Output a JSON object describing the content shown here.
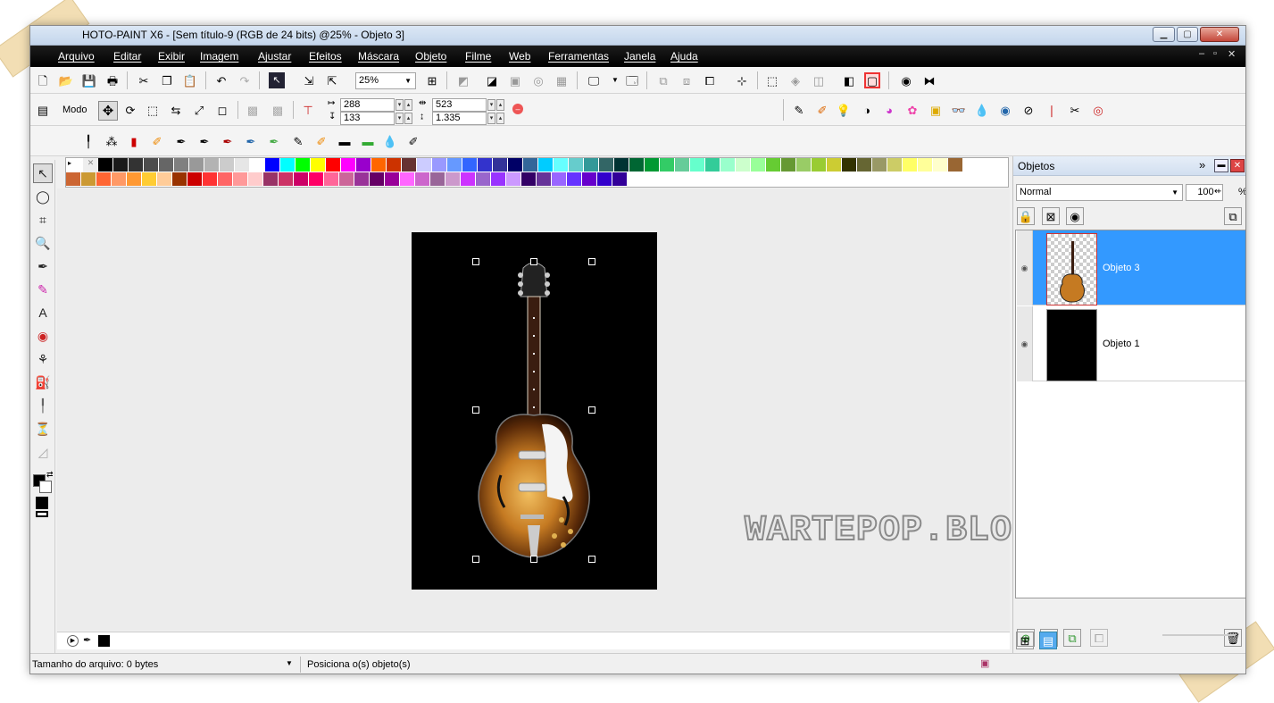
{
  "window": {
    "title": "HOTO-PAINT X6 - [Sem título-9 (RGB de 24 bits) @25% - Objeto 3]",
    "controls": [
      "minimize",
      "maximize",
      "close"
    ]
  },
  "menu": [
    "Arquivo",
    "Editar",
    "Exibir",
    "Imagem",
    "Ajustar",
    "Efeitos",
    "Máscara",
    "Objeto",
    "Filme",
    "Web",
    "Ferramentas",
    "Janela",
    "Ajuda"
  ],
  "toolbar": {
    "zoom": "25%"
  },
  "property_bar": {
    "mode_label": "Modo",
    "x": "288",
    "y": "133",
    "width": "523",
    "height": "1.335"
  },
  "objects_panel": {
    "title": "Objetos",
    "blend_mode": "Normal",
    "opacity": "100",
    "opacity_unit": "%",
    "layers": [
      {
        "name": "Objeto 3",
        "selected": true
      },
      {
        "name": "Objeto 1",
        "selected": false
      }
    ]
  },
  "watermark": "WARTEPOP.BLOGSPOT.COM",
  "status": {
    "file_size": "Tamanho do arquivo: 0 bytes",
    "hint": "Posiciona o(s) objeto(s)"
  },
  "colors": {
    "menubar": "#000000",
    "selection": "#3399ff",
    "palette_row1": [
      "#000000",
      "#1a1a1a",
      "#333333",
      "#4d4d4d",
      "#666666",
      "#808080",
      "#999999",
      "#b3b3b3",
      "#cccccc",
      "#e6e6e6",
      "#ffffff",
      "#0000ff",
      "#00ffff",
      "#00ff00",
      "#ffff00",
      "#ff0000",
      "#ff00ff",
      "#9900cc",
      "#ff6600",
      "#cc3300",
      "#663333",
      "#ccccff",
      "#9999ff",
      "#6699ff",
      "#3366ff",
      "#3333cc",
      "#333399",
      "#000066",
      "#336699",
      "#00ccff",
      "#66ffff",
      "#66cccc",
      "#339999",
      "#336666",
      "#003333",
      "#006633",
      "#009933",
      "#33cc66",
      "#66cc99",
      "#66ffcc",
      "#33cc99",
      "#99ffcc",
      "#ccffcc",
      "#99ff99",
      "#66cc33",
      "#669933",
      "#99cc66",
      "#99cc33",
      "#cccc33",
      "#333300",
      "#666633",
      "#999966",
      "#cccc66",
      "#ffff66",
      "#ffff99",
      "#ffffcc",
      "#996633"
    ],
    "palette_row2": [
      "#cc6633",
      "#cc9933",
      "#ff6633",
      "#ff9966",
      "#ff9933",
      "#ffcc33",
      "#ffcc99",
      "#993300",
      "#cc0000",
      "#ff3333",
      "#ff6666",
      "#ff9999",
      "#ffcccc",
      "#993366",
      "#cc3366",
      "#cc0066",
      "#ff0066",
      "#ff6699",
      "#cc6699",
      "#993399",
      "#660066",
      "#990099",
      "#ff66ff",
      "#cc66cc",
      "#996699",
      "#cc99cc",
      "#cc33ff",
      "#9966cc",
      "#9933ff",
      "#cc99ff",
      "#330066",
      "#663399",
      "#9966ff",
      "#6633ff",
      "#6600cc",
      "#3300cc",
      "#330099"
    ]
  }
}
